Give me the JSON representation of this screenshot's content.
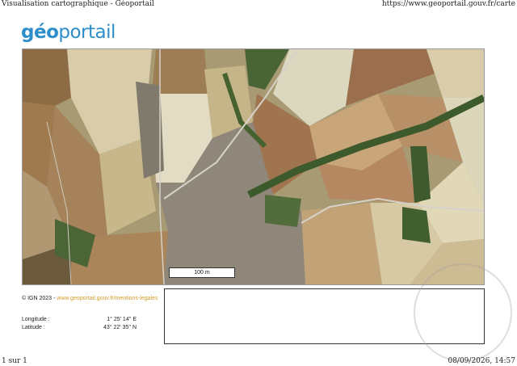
{
  "browser": {
    "page_title": "Visualisation cartographique - Géoportail",
    "url": "https://www.geoportail.gouv.fr/carte",
    "page_number": "1 sur 1",
    "timestamp": "08/09/2026, 14:57"
  },
  "logo": {
    "part1": "géo",
    "part2": "portail"
  },
  "map": {
    "scale_label": "100 m",
    "colors": {
      "field_light": "#c9bb8f",
      "field_dark": "#9b7a52",
      "vegetation": "#3f5a2e",
      "road": "#d9d6cf",
      "urban": "#8a8577"
    }
  },
  "footer": {
    "copyright_text": "© IGN 2023 - ",
    "copyright_link": "www.geoportail.gouv.fr/mentions-legales",
    "longitude_label": "Longitude :",
    "longitude_value": "1° 25' 14'' E",
    "latitude_label": "Latitude :",
    "latitude_value": "43° 22' 35'' N"
  }
}
